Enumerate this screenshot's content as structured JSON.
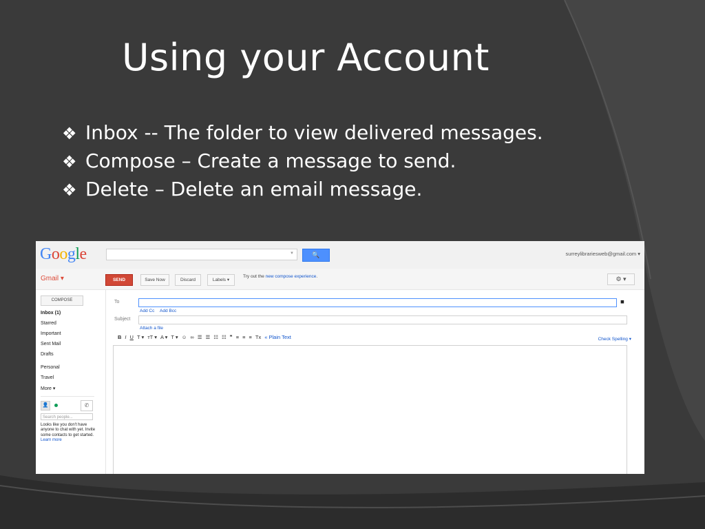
{
  "slide": {
    "title": "Using your Account",
    "bullets": [
      {
        "glyph": "❖",
        "text": "Inbox  -- The folder to view delivered messages."
      },
      {
        "glyph": "❖",
        "text": "Compose – Create a message to send."
      },
      {
        "glyph": "❖",
        "text": "Delete – Delete an email message."
      }
    ]
  },
  "gmail": {
    "search_button": "🔍",
    "account": "surreylibrariesweb@gmail.com ▾",
    "app_label": "Gmail ▾",
    "toolbar": {
      "send": "SEND",
      "save": "Save Now",
      "discard": "Discard",
      "labels": "Labels ▾",
      "promo_prefix": "Try out the ",
      "promo_link": "new compose experience",
      "promo_suffix": ".",
      "settings": "⚙ ▾"
    },
    "sidebar": {
      "compose": "COMPOSE",
      "items": [
        "Inbox (1)",
        "Starred",
        "Important",
        "Sent Mail",
        "Drafts",
        "Personal",
        "Travel",
        "More ▾"
      ],
      "people_search_placeholder": "Search people...",
      "chat_note": "Looks like you don't have anyone to chat with yet. Invite some contacts to get started.",
      "learn_more": "Learn more"
    },
    "compose_form": {
      "to_label": "To",
      "add_cc": "Add Cc",
      "add_bcc": "Add Bcc",
      "subject_label": "Subject",
      "attach": "Attach a file",
      "format_tools": [
        "B",
        "I",
        "U",
        "T ▾",
        "тT ▾",
        "A ▾",
        "T ▾",
        "☺",
        "∞",
        "☰",
        "☰",
        "☷",
        "☷",
        "❞",
        "≡",
        "≡",
        "≡",
        "Tx"
      ],
      "plain_text": "« Plain Text",
      "check_spelling": "Check Spelling ▾"
    }
  },
  "colors": {
    "slide_bg": "#3b3b3b",
    "send_red": "#d14836",
    "search_blue": "#4d90fe",
    "gmail_red": "#dd4b39",
    "link_blue": "#1155cc"
  }
}
